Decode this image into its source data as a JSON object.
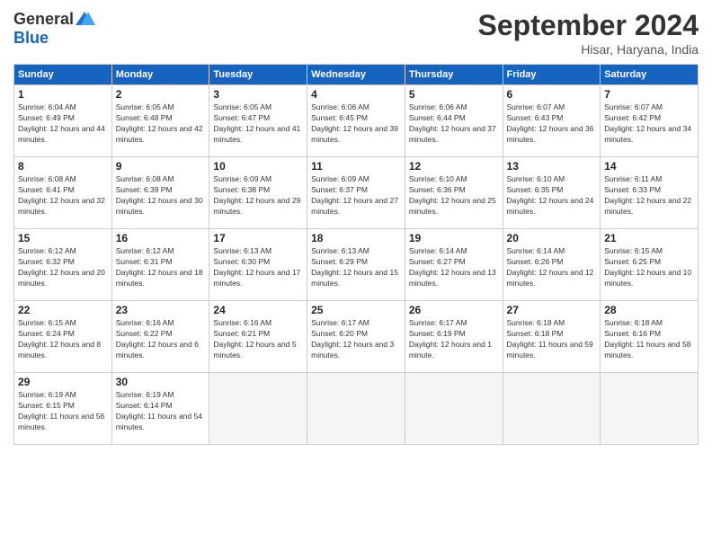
{
  "logo": {
    "general": "General",
    "blue": "Blue"
  },
  "title": "September 2024",
  "location": "Hisar, Haryana, India",
  "headers": [
    "Sunday",
    "Monday",
    "Tuesday",
    "Wednesday",
    "Thursday",
    "Friday",
    "Saturday"
  ],
  "days": [
    {
      "date": "1",
      "sunrise": "6:04 AM",
      "sunset": "6:49 PM",
      "daylight": "12 hours and 44 minutes."
    },
    {
      "date": "2",
      "sunrise": "6:05 AM",
      "sunset": "6:48 PM",
      "daylight": "12 hours and 42 minutes."
    },
    {
      "date": "3",
      "sunrise": "6:05 AM",
      "sunset": "6:47 PM",
      "daylight": "12 hours and 41 minutes."
    },
    {
      "date": "4",
      "sunrise": "6:06 AM",
      "sunset": "6:45 PM",
      "daylight": "12 hours and 39 minutes."
    },
    {
      "date": "5",
      "sunrise": "6:06 AM",
      "sunset": "6:44 PM",
      "daylight": "12 hours and 37 minutes."
    },
    {
      "date": "6",
      "sunrise": "6:07 AM",
      "sunset": "6:43 PM",
      "daylight": "12 hours and 36 minutes."
    },
    {
      "date": "7",
      "sunrise": "6:07 AM",
      "sunset": "6:42 PM",
      "daylight": "12 hours and 34 minutes."
    },
    {
      "date": "8",
      "sunrise": "6:08 AM",
      "sunset": "6:41 PM",
      "daylight": "12 hours and 32 minutes."
    },
    {
      "date": "9",
      "sunrise": "6:08 AM",
      "sunset": "6:39 PM",
      "daylight": "12 hours and 30 minutes."
    },
    {
      "date": "10",
      "sunrise": "6:09 AM",
      "sunset": "6:38 PM",
      "daylight": "12 hours and 29 minutes."
    },
    {
      "date": "11",
      "sunrise": "6:09 AM",
      "sunset": "6:37 PM",
      "daylight": "12 hours and 27 minutes."
    },
    {
      "date": "12",
      "sunrise": "6:10 AM",
      "sunset": "6:36 PM",
      "daylight": "12 hours and 25 minutes."
    },
    {
      "date": "13",
      "sunrise": "6:10 AM",
      "sunset": "6:35 PM",
      "daylight": "12 hours and 24 minutes."
    },
    {
      "date": "14",
      "sunrise": "6:11 AM",
      "sunset": "6:33 PM",
      "daylight": "12 hours and 22 minutes."
    },
    {
      "date": "15",
      "sunrise": "6:12 AM",
      "sunset": "6:32 PM",
      "daylight": "12 hours and 20 minutes."
    },
    {
      "date": "16",
      "sunrise": "6:12 AM",
      "sunset": "6:31 PM",
      "daylight": "12 hours and 18 minutes."
    },
    {
      "date": "17",
      "sunrise": "6:13 AM",
      "sunset": "6:30 PM",
      "daylight": "12 hours and 17 minutes."
    },
    {
      "date": "18",
      "sunrise": "6:13 AM",
      "sunset": "6:29 PM",
      "daylight": "12 hours and 15 minutes."
    },
    {
      "date": "19",
      "sunrise": "6:14 AM",
      "sunset": "6:27 PM",
      "daylight": "12 hours and 13 minutes."
    },
    {
      "date": "20",
      "sunrise": "6:14 AM",
      "sunset": "6:26 PM",
      "daylight": "12 hours and 12 minutes."
    },
    {
      "date": "21",
      "sunrise": "6:15 AM",
      "sunset": "6:25 PM",
      "daylight": "12 hours and 10 minutes."
    },
    {
      "date": "22",
      "sunrise": "6:15 AM",
      "sunset": "6:24 PM",
      "daylight": "12 hours and 8 minutes."
    },
    {
      "date": "23",
      "sunrise": "6:16 AM",
      "sunset": "6:22 PM",
      "daylight": "12 hours and 6 minutes."
    },
    {
      "date": "24",
      "sunrise": "6:16 AM",
      "sunset": "6:21 PM",
      "daylight": "12 hours and 5 minutes."
    },
    {
      "date": "25",
      "sunrise": "6:17 AM",
      "sunset": "6:20 PM",
      "daylight": "12 hours and 3 minutes."
    },
    {
      "date": "26",
      "sunrise": "6:17 AM",
      "sunset": "6:19 PM",
      "daylight": "12 hours and 1 minute."
    },
    {
      "date": "27",
      "sunrise": "6:18 AM",
      "sunset": "6:18 PM",
      "daylight": "11 hours and 59 minutes."
    },
    {
      "date": "28",
      "sunrise": "6:18 AM",
      "sunset": "6:16 PM",
      "daylight": "11 hours and 58 minutes."
    },
    {
      "date": "29",
      "sunrise": "6:19 AM",
      "sunset": "6:15 PM",
      "daylight": "11 hours and 56 minutes."
    },
    {
      "date": "30",
      "sunrise": "6:19 AM",
      "sunset": "6:14 PM",
      "daylight": "11 hours and 54 minutes."
    }
  ]
}
